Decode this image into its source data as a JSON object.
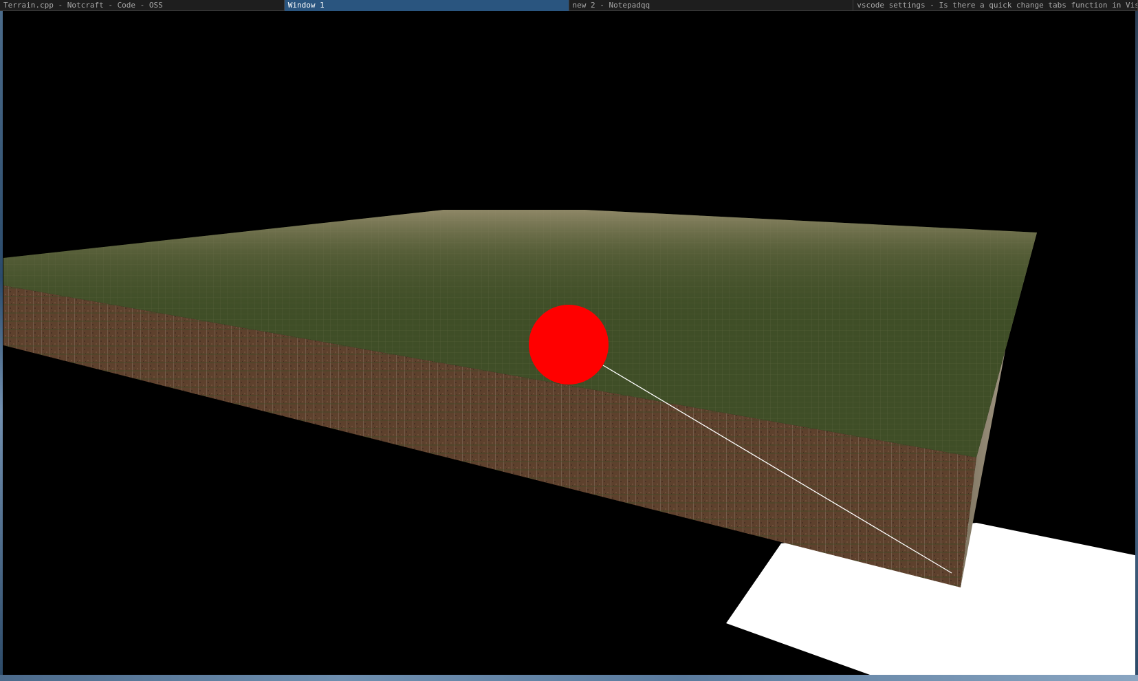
{
  "taskbar": {
    "tabs": [
      {
        "label": "Terrain.cpp - Notcraft - Code - OSS",
        "active": false
      },
      {
        "label": "Window 1",
        "active": true
      },
      {
        "label": "new 2 - Notepadqq",
        "active": false
      },
      {
        "label": "vscode settings - Is there a quick change tabs function in Visual Studio Code? - Stack Overflow - Chromium",
        "active": false
      }
    ]
  },
  "scene": {
    "background_color": "#000000",
    "grass_color": "#3f4e27",
    "dirt_color": "#6b4a34",
    "marker_color": "#ff0000",
    "ray_color": "#ffffff",
    "ground_plane_color": "#ffffff"
  }
}
